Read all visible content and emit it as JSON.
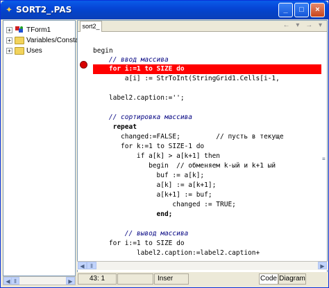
{
  "window": {
    "title": "SORT2_.PAS",
    "minimize": "_",
    "maximize": "□",
    "close": "×"
  },
  "tree": {
    "items": [
      {
        "expander": "+",
        "label": "TForm1"
      },
      {
        "expander": "+",
        "label": "Variables/Consta"
      },
      {
        "expander": "+",
        "label": "Uses"
      }
    ]
  },
  "editor": {
    "tab_label": "sort2_",
    "nav_arrows": "← ▾ → ▾",
    "lines": [
      {
        "text": "begin",
        "style": "kw"
      },
      {
        "text": "    // ввод массива",
        "style": "cm"
      },
      {
        "text": "    for i:=1 to SIZE do",
        "style": "bp"
      },
      {
        "text": "        a[i] := StrToInt(StringGrid1.Cells[i-1,",
        "style": "normal"
      },
      {
        "text": "",
        "style": "normal"
      },
      {
        "text": "    label2.caption:='';",
        "style": "normal"
      },
      {
        "text": "",
        "style": "normal"
      },
      {
        "text": "    // сортировка массива",
        "style": "cm"
      },
      {
        "text": "     repeat",
        "style": "kw"
      },
      {
        "text": "       changed:=FALSE;         // пусть в текуще",
        "style": "mixed"
      },
      {
        "text": "       for k:=1 to SIZE-1 do",
        "style": "normal"
      },
      {
        "text": "           if a[k] > a[k+1] then",
        "style": "normal"
      },
      {
        "text": "              begin  // обменяем k-ый и k+1 ый",
        "style": "mixed2"
      },
      {
        "text": "                buf := a[k];",
        "style": "normal"
      },
      {
        "text": "                a[k] := a[k+1];",
        "style": "normal"
      },
      {
        "text": "                a[k+1] := buf;",
        "style": "normal"
      },
      {
        "text": "                    changed := TRUE;",
        "style": "normal"
      },
      {
        "text": "                end;",
        "style": "kw"
      },
      {
        "text": "",
        "style": "normal"
      },
      {
        "text": "        // вывод массива",
        "style": "cm"
      },
      {
        "text": "    for i:=1 to SIZE do",
        "style": "normal"
      },
      {
        "text": "           label2.caption:=label2.caption+",
        "style": "normal"
      }
    ]
  },
  "status": {
    "position": "43: 1",
    "cell2": "",
    "mode": "Inser",
    "tab_code": "Code",
    "tab_diagram": "Diagram"
  }
}
